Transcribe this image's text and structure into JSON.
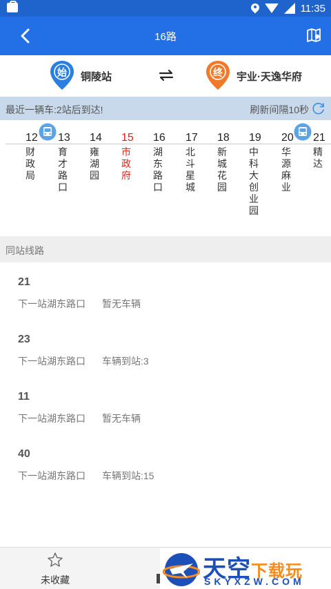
{
  "statusbar": {
    "time": "11:35"
  },
  "header": {
    "title": "16路"
  },
  "endpoints": {
    "start": {
      "badge": "始",
      "name": "铜陵站",
      "color": "#2a7fe0"
    },
    "end": {
      "badge": "终",
      "name": "宇业·天逸华府",
      "color": "#f07a2a"
    }
  },
  "info": {
    "nearest": "最近一辆车:2站后到达!",
    "refresh": "刷新间隔10秒"
  },
  "stops": [
    {
      "num": "12",
      "name": "财政局"
    },
    {
      "num": "13",
      "name": "育才路口"
    },
    {
      "num": "14",
      "name": "雍湖园"
    },
    {
      "num": "15",
      "name": "市政府",
      "current": true
    },
    {
      "num": "16",
      "name": "湖东路口"
    },
    {
      "num": "17",
      "name": "北斗星城"
    },
    {
      "num": "18",
      "name": "新城花园"
    },
    {
      "num": "19",
      "name": "中科大创业园"
    },
    {
      "num": "20",
      "name": "华源麻业"
    },
    {
      "num": "21",
      "name": "精达"
    }
  ],
  "section": {
    "title": "同站线路"
  },
  "routes": [
    {
      "num": "21",
      "next": "下一站湖东路口",
      "status": "暂无车辆"
    },
    {
      "num": "23",
      "next": "下一站湖东路口",
      "status": "车辆到站:3"
    },
    {
      "num": "11",
      "next": "下一站湖东路口",
      "status": "暂无车辆"
    },
    {
      "num": "40",
      "next": "下一站湖东路口",
      "status": "车辆到站:15"
    }
  ],
  "tabbar": {
    "favorite": "未收藏"
  },
  "watermark": {
    "main": "天空",
    "accent": "下载玩",
    "sub": "SKYXZW.COM"
  },
  "colors": {
    "appbar": "#2370e6",
    "current_stop": "#d9261c",
    "info_bg": "#c9d9ec"
  }
}
